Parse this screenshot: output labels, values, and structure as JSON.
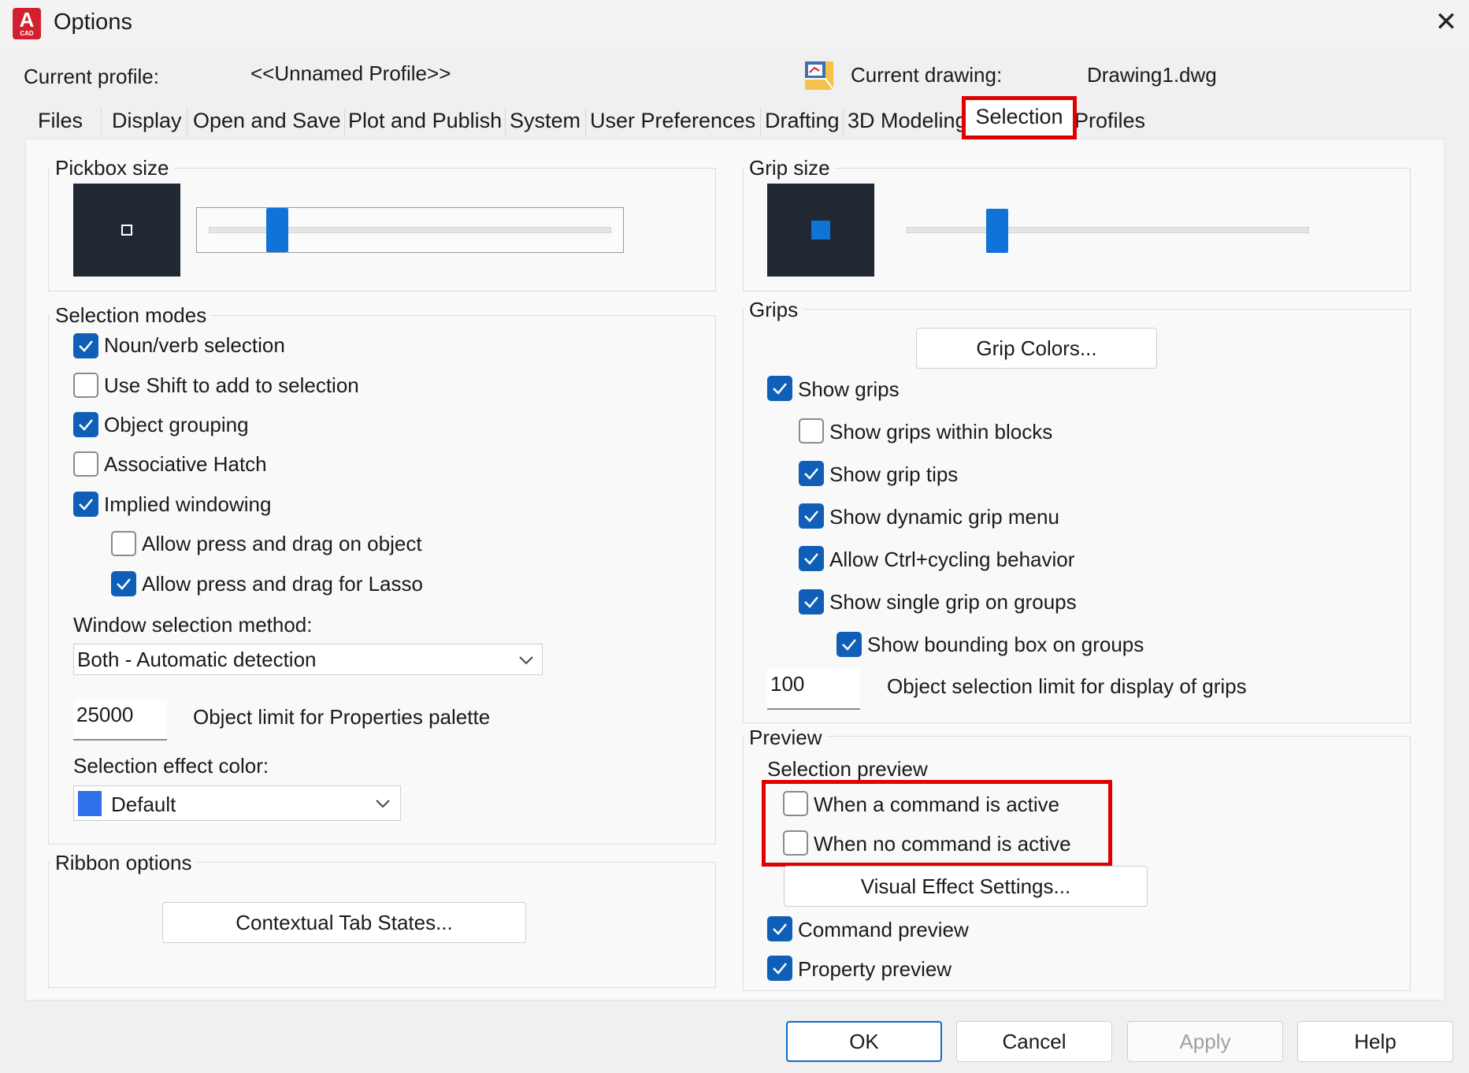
{
  "window": {
    "title": "Options",
    "icon_text_main": "A",
    "icon_text_sub": "CAD",
    "close_icon": "close-icon"
  },
  "profile": {
    "current_profile_label": "Current profile:",
    "current_profile_value": "<<Unnamed Profile>>",
    "current_drawing_label": "Current drawing:",
    "current_drawing_value": "Drawing1.dwg"
  },
  "tabs": [
    {
      "label": "Files"
    },
    {
      "label": "Display"
    },
    {
      "label": "Open and Save"
    },
    {
      "label": "Plot and Publish"
    },
    {
      "label": "System"
    },
    {
      "label": "User Preferences"
    },
    {
      "label": "Drafting"
    },
    {
      "label": "3D Modeling"
    },
    {
      "label": "Selection",
      "active": true
    },
    {
      "label": "Profiles"
    }
  ],
  "pickbox": {
    "title": "Pickbox size",
    "slider_level_percent": 17
  },
  "grip_size": {
    "title": "Grip size",
    "slider_level_percent": 22
  },
  "selection_modes": {
    "title": "Selection modes",
    "items": [
      {
        "label": "Noun/verb selection",
        "checked": true
      },
      {
        "label": "Use Shift to add to selection",
        "checked": false
      },
      {
        "label": "Object grouping",
        "checked": true
      },
      {
        "label": "Associative Hatch",
        "checked": false
      },
      {
        "label": "Implied windowing",
        "checked": true
      },
      {
        "label": "Allow press and drag on object",
        "checked": false
      },
      {
        "label": "Allow press and drag for Lasso",
        "checked": true
      }
    ],
    "window_method_label": "Window selection method:",
    "window_method_value": "Both - Automatic detection",
    "object_limit_value": "25000",
    "object_limit_label": "Object limit for Properties palette",
    "effect_color_label": "Selection effect color:",
    "effect_color_value": "Default",
    "effect_color_swatch": "#2f6fe8"
  },
  "ribbon": {
    "title": "Ribbon options",
    "contextual_button": "Contextual Tab States..."
  },
  "grips": {
    "title": "Grips",
    "grip_colors_button": "Grip Colors...",
    "items": [
      {
        "label": "Show grips",
        "checked": true
      },
      {
        "label": "Show grips within blocks",
        "checked": false
      },
      {
        "label": "Show grip tips",
        "checked": true
      },
      {
        "label": "Show dynamic grip menu",
        "checked": true
      },
      {
        "label": "Allow Ctrl+cycling behavior",
        "checked": true
      },
      {
        "label": "Show single grip on groups",
        "checked": true
      },
      {
        "label": "Show bounding box on groups",
        "checked": true
      }
    ],
    "limit_value": "100",
    "limit_label": "Object selection limit for display of grips"
  },
  "preview": {
    "title": "Preview",
    "selection_preview_label": "Selection preview",
    "items": [
      {
        "label": "When a command is active",
        "checked": false
      },
      {
        "label": "When no command is active",
        "checked": false
      }
    ],
    "visual_effect_button": "Visual Effect Settings...",
    "command_preview": {
      "label": "Command preview",
      "checked": true
    },
    "property_preview": {
      "label": "Property preview",
      "checked": true
    }
  },
  "buttons": {
    "ok": "OK",
    "cancel": "Cancel",
    "apply": "Apply",
    "help": "Help"
  },
  "colors": {
    "accent": "#0f5fb8",
    "highlight": "#e00000",
    "preview_bg": "#212833",
    "slider_thumb": "#0f73d8"
  }
}
